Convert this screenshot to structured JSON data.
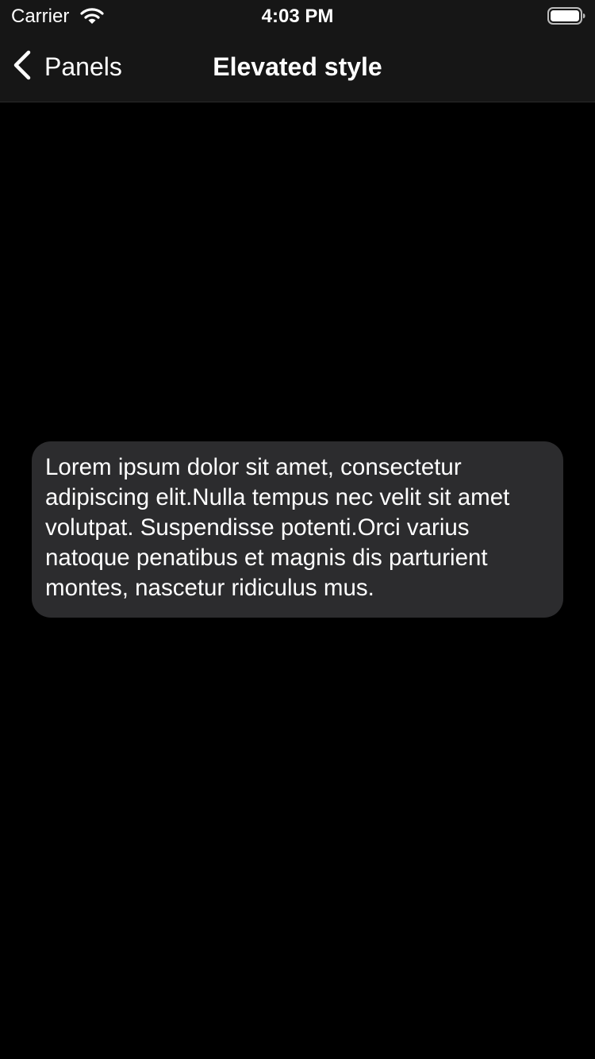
{
  "status_bar": {
    "carrier": "Carrier",
    "time": "4:03 PM",
    "wifi_icon": "wifi-icon",
    "battery_icon": "battery-icon"
  },
  "nav_bar": {
    "back_label": "Panels",
    "back_icon": "chevron-left-icon",
    "title": "Elevated style"
  },
  "panel": {
    "text": "Lorem ipsum dolor sit amet, consectetur adipiscing elit.Nulla tempus nec velit sit amet volutpat. Suspendisse potenti.Orci varius natoque penatibus et magnis dis parturient montes, nascetur ridiculus mus."
  },
  "colors": {
    "background": "#000000",
    "bar_background": "#161616",
    "panel_background": "#2c2c2e",
    "text": "#ffffff"
  }
}
